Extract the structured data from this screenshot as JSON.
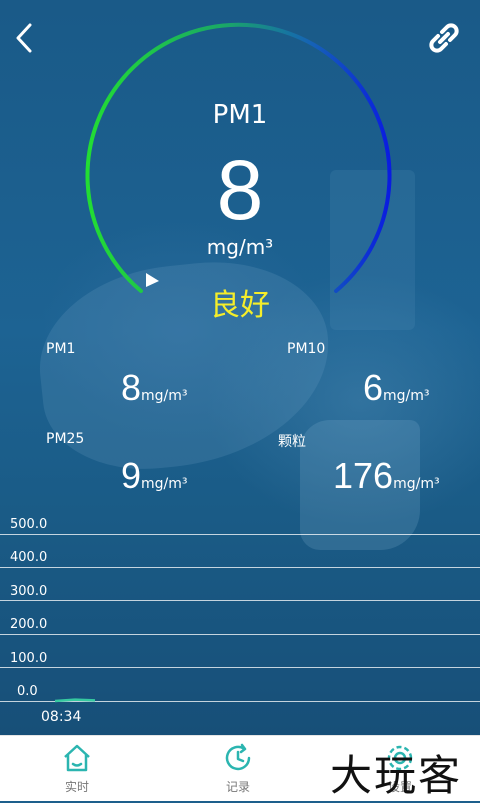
{
  "gauge": {
    "name": "PM1",
    "value": "8",
    "unit": "mg/m³",
    "status": "良好",
    "arc_colors": [
      "#22dd33",
      "#0a1ce0"
    ]
  },
  "readings": [
    {
      "label": "PM1",
      "value": "8",
      "unit": "mg/m³"
    },
    {
      "label": "PM10",
      "value": "6",
      "unit": "mg/m³"
    },
    {
      "label": "PM25",
      "value": "9",
      "unit": "mg/m³"
    },
    {
      "label": "颗粒",
      "value": "176",
      "unit": "mg/m³"
    }
  ],
  "chart_data": {
    "type": "line",
    "y_ticks": [
      "500.0",
      "400.0",
      "300.0",
      "200.0",
      "100.0",
      "0.0"
    ],
    "ylim": [
      0,
      500
    ],
    "x_labels": [
      "08:34"
    ],
    "series": [
      {
        "values": [
          0,
          4,
          2
        ]
      }
    ],
    "series_color": "#35c9a0"
  },
  "tabs": [
    {
      "label": "实时",
      "icon": "home-icon"
    },
    {
      "label": "记录",
      "icon": "history-icon"
    },
    {
      "label": "设置",
      "icon": "gear-icon"
    }
  ],
  "watermark": "大玩客",
  "colors": {
    "background": "#1d5f8c",
    "status": "#f5ee2a",
    "tab_icon": "#2bb5b0"
  }
}
